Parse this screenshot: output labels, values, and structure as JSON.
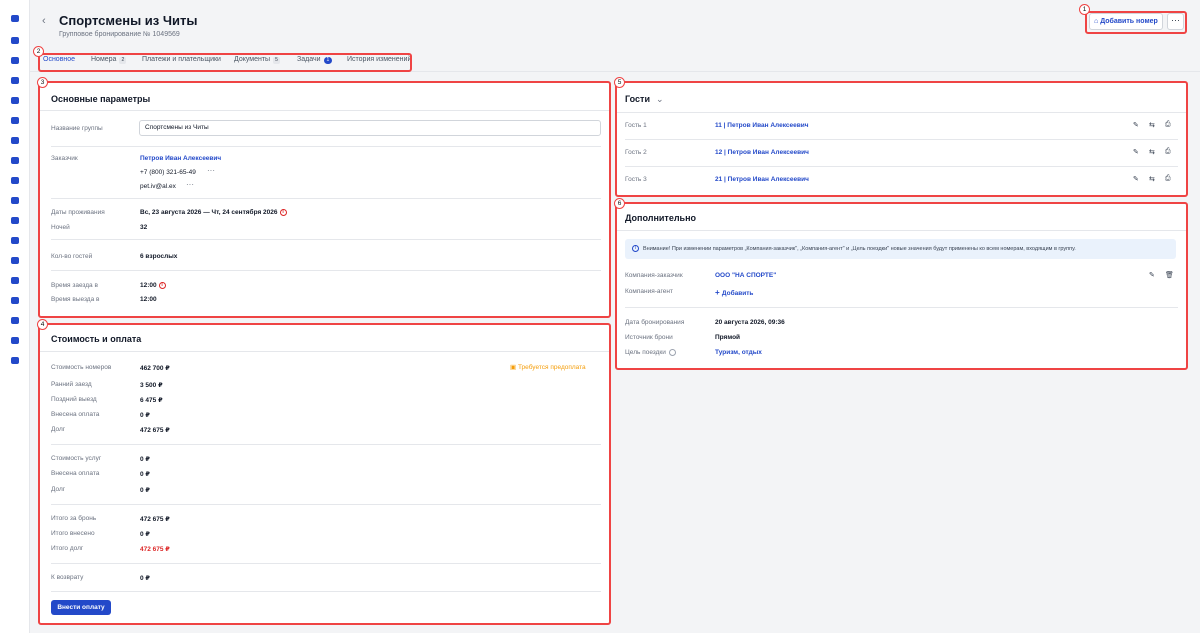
{
  "header": {
    "title": "Спортсмены из Читы",
    "subtitle": "Групповое бронирование № 1049569",
    "add_room_label": "Добавить номер",
    "more_label": "···"
  },
  "tabs": [
    {
      "label": "Основное"
    },
    {
      "label": "Номера",
      "badge": "2"
    },
    {
      "label": "Платежи и плательщики"
    },
    {
      "label": "Документы",
      "badge": "5"
    },
    {
      "label": "Задачи",
      "badge": "1"
    },
    {
      "label": "История изменений"
    }
  ],
  "markers": [
    "1",
    "2",
    "3",
    "4",
    "5",
    "6"
  ],
  "main_params": {
    "title": "Основные параметры",
    "group_name_label": "Название группы",
    "group_name_value": "Спортсмены из Читы",
    "customer_label": "Заказчик",
    "customer_name": "Петров Иван Алексеевич",
    "customer_phone": "+7 (800) 321-65-49",
    "customer_email": "pet.iv@al.ex",
    "dates_label": "Даты проживания",
    "dates_value": "Вс, 23 августа 2026 — Чт, 24 сентября 2026",
    "nights_label": "Ночей",
    "nights_value": "32",
    "guests_count_label": "Кол-во гостей",
    "guests_count_value": "6 взрослых",
    "checkin_label": "Время заезда в",
    "checkin_value": "12:00",
    "checkout_label": "Время выезда в",
    "checkout_value": "12:00"
  },
  "cost": {
    "title": "Стоимость и оплата",
    "prepayment_required": "Требуется предоплата",
    "rows": [
      {
        "label": "Стоимость номеров",
        "value": "462 700 ₽"
      },
      {
        "label": "Ранний заезд",
        "value": "3 500 ₽"
      },
      {
        "label": "Поздний выезд",
        "value": "6 475 ₽"
      },
      {
        "label": "Внесена оплата",
        "value": "0 ₽"
      },
      {
        "label": "Долг",
        "value": "472 675 ₽"
      },
      {
        "label": "Стоимость услуг",
        "value": "0 ₽"
      },
      {
        "label": "Внесена оплата",
        "value": "0 ₽"
      },
      {
        "label": "Долг",
        "value": "0 ₽"
      },
      {
        "label": "Итого за бронь",
        "value": "472 675 ₽"
      },
      {
        "label": "Итого внесено",
        "value": "0 ₽"
      },
      {
        "label": "Итого долг",
        "value": "472 675 ₽"
      },
      {
        "label": "К возврату",
        "value": "0 ₽"
      }
    ],
    "pay_button": "Внести оплату"
  },
  "guests": {
    "title": "Гости",
    "items": [
      {
        "label": "Гость 1",
        "value": "11 | Петров Иван Алексеевич"
      },
      {
        "label": "Гость 2",
        "value": "12 | Петров Иван Алексеевич"
      },
      {
        "label": "Гость 3",
        "value": "21 | Петров Иван Алексеевич"
      }
    ]
  },
  "extra": {
    "title": "Дополнительно",
    "notice": "Внимание! При изменении параметров „Компания-заказчик\", „Компания-агент\" и „Цель поездки\" новые значения будут применены ко всем номерам, входящим в группу.",
    "company_customer_label": "Компания-заказчик",
    "company_customer_value": "ООО \"НА СПОРТЕ\"",
    "company_agent_label": "Компания-агент",
    "company_agent_add": "Добавить",
    "booking_date_label": "Дата бронирования",
    "booking_date_value": "20 августа 2026, 09:36",
    "source_label": "Источник брони",
    "source_value": "Прямой",
    "purpose_label": "Цель поездки",
    "purpose_value": "Туризм, отдых"
  },
  "colors": {
    "accent": "#2349c9",
    "annotation": "#ef4444",
    "debt": "#dc2626",
    "warning": "#f59e0b"
  }
}
